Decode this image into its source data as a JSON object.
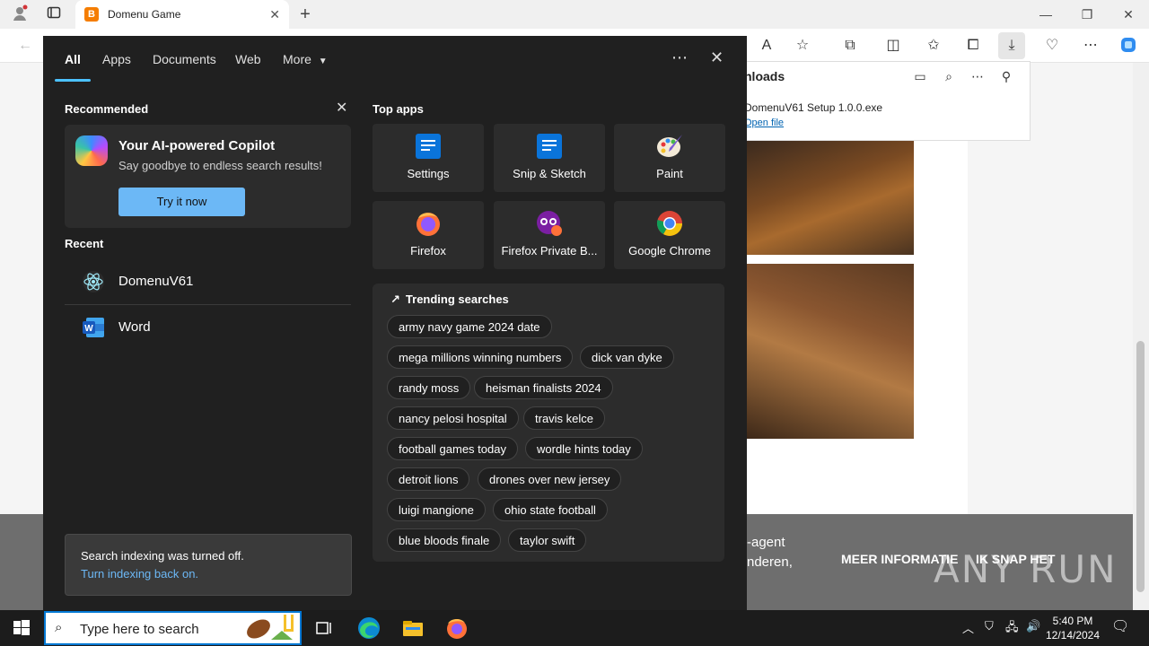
{
  "browser": {
    "tab_title": "Domenu Game",
    "tab_favicon": "B"
  },
  "downloads": {
    "title": "nloads",
    "file_name": "DomenuV61 Setup 1.0.0.exe",
    "open_link": "Open file"
  },
  "page": {
    "footer_text_1": "-agent",
    "footer_text_2": "nderen,",
    "more_info": "MEER INFORMATIE",
    "got_it": "IK SNAP HET",
    "watermark": "ANY RUN"
  },
  "search_panel": {
    "tabs": [
      "All",
      "Apps",
      "Documents",
      "Web",
      "More"
    ],
    "recommended_title": "Recommended",
    "copilot": {
      "title": "Your AI-powered Copilot",
      "subtitle": "Say goodbye to endless search results!",
      "button": "Try it now"
    },
    "recent_title": "Recent",
    "recent_items": [
      {
        "label": "DomenuV61",
        "icon": "electron-icon"
      },
      {
        "label": "Word",
        "icon": "word-icon"
      }
    ],
    "indexing": {
      "line1": "Search indexing was turned off.",
      "line2": "Turn indexing back on."
    },
    "top_apps_title": "Top apps",
    "top_apps": [
      {
        "label": "Settings",
        "icon": "settings-icon"
      },
      {
        "label": "Snip & Sketch",
        "icon": "snip-sketch-icon"
      },
      {
        "label": "Paint",
        "icon": "paint-icon"
      },
      {
        "label": "Firefox",
        "icon": "firefox-icon"
      },
      {
        "label": "Firefox Private B...",
        "icon": "firefox-private-icon"
      },
      {
        "label": "Google Chrome",
        "icon": "chrome-icon"
      }
    ],
    "trending_title": "Trending searches",
    "trending": [
      "army navy game 2024 date",
      "mega millions winning numbers",
      "dick van dyke",
      "randy moss",
      "heisman finalists 2024",
      "nancy pelosi hospital",
      "travis kelce",
      "football games today",
      "wordle hints today",
      "detroit lions",
      "drones over new jersey",
      "luigi mangione",
      "ohio state football",
      "blue bloods finale",
      "taylor swift"
    ]
  },
  "taskbar": {
    "search_placeholder": "Type here to search",
    "time": "5:40 PM",
    "date": "12/14/2024"
  },
  "colors": {
    "panel_bg": "#202020",
    "tile_bg": "#2c2c2c",
    "accent": "#4cc2ff",
    "button": "#6cb8f6"
  }
}
